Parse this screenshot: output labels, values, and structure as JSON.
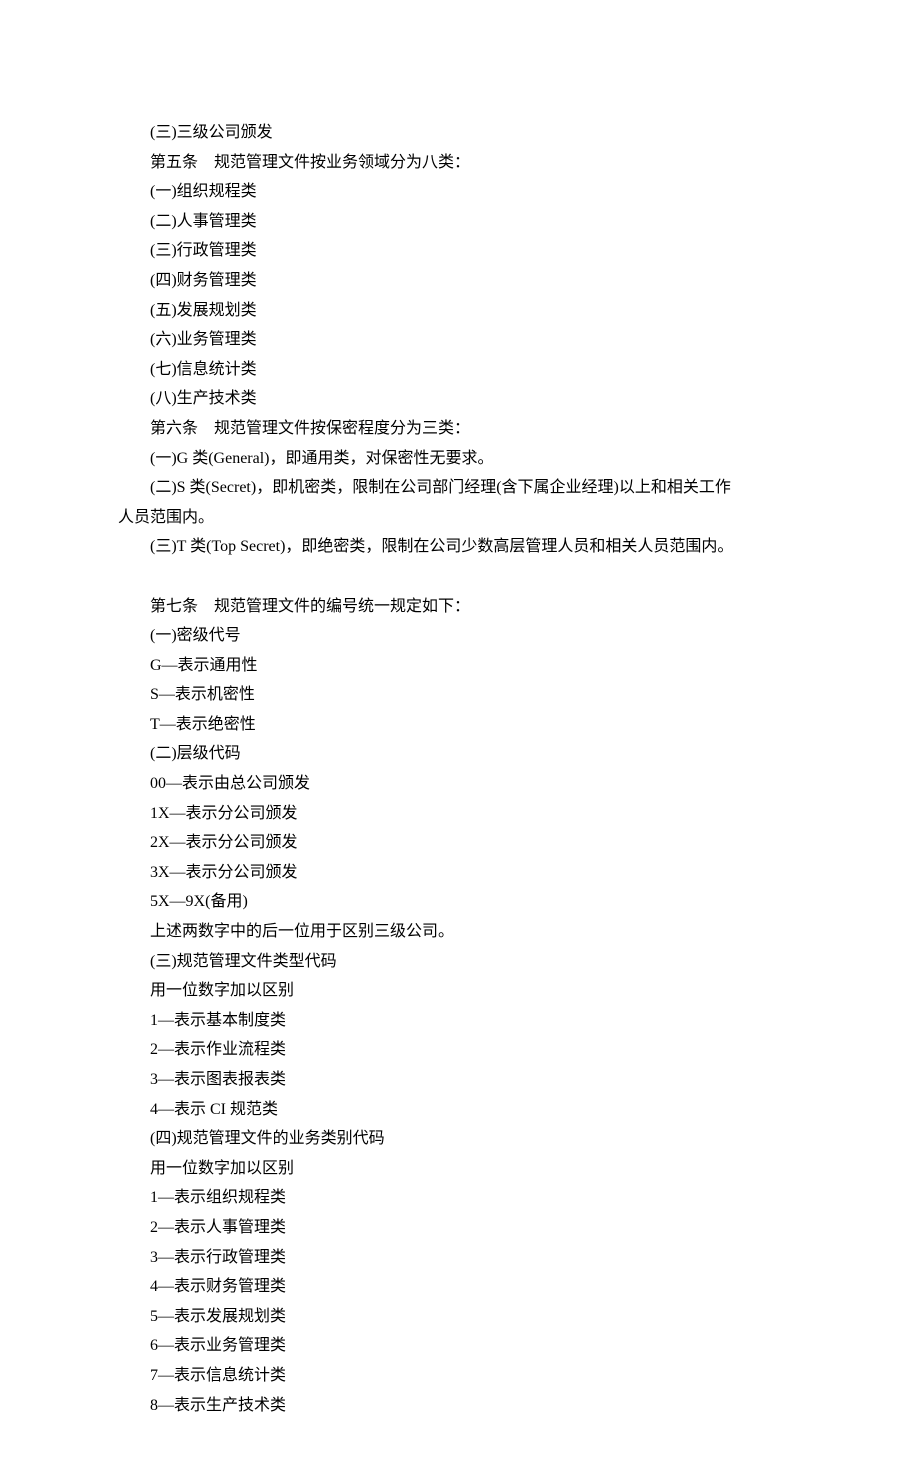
{
  "lines": [
    {
      "text": "(三)三级公司颁发",
      "indent": true
    },
    {
      "text": "第五条　规范管理文件按业务领域分为八类：",
      "indent": true
    },
    {
      "text": "(一)组织规程类",
      "indent": true
    },
    {
      "text": "(二)人事管理类",
      "indent": true
    },
    {
      "text": "(三)行政管理类",
      "indent": true
    },
    {
      "text": "(四)财务管理类",
      "indent": true
    },
    {
      "text": "(五)发展规划类",
      "indent": true
    },
    {
      "text": "(六)业务管理类",
      "indent": true
    },
    {
      "text": "(七)信息统计类",
      "indent": true
    },
    {
      "text": "(八)生产技术类",
      "indent": true
    },
    {
      "text": "第六条　规范管理文件按保密程度分为三类：",
      "indent": true
    },
    {
      "text": "(一)G 类(General)，即通用类，对保密性无要求。",
      "indent": true
    },
    {
      "text": "(二)S 类(Secret)，即机密类，限制在公司部门经理(含下属企业经理)以上和相关工作",
      "indent": true
    },
    {
      "text": "人员范围内。",
      "indent": false
    },
    {
      "text": "(三)T 类(Top Secret)，即绝密类，限制在公司少数高层管理人员和相关人员范围内。",
      "indent": true
    },
    {
      "spacer": true
    },
    {
      "text": "第七条　规范管理文件的编号统一规定如下：",
      "indent": true
    },
    {
      "text": "(一)密级代号",
      "indent": true
    },
    {
      "text": "G—表示通用性",
      "indent": true
    },
    {
      "text": "S—表示机密性",
      "indent": true
    },
    {
      "text": "T—表示绝密性",
      "indent": true
    },
    {
      "text": "(二)层级代码",
      "indent": true
    },
    {
      "text": "00—表示由总公司颁发",
      "indent": true
    },
    {
      "text": "1X—表示分公司颁发",
      "indent": true
    },
    {
      "text": "2X—表示分公司颁发",
      "indent": true
    },
    {
      "text": "3X—表示分公司颁发",
      "indent": true
    },
    {
      "text": "5X—9X(备用)",
      "indent": true
    },
    {
      "text": "上述两数字中的后一位用于区别三级公司。",
      "indent": true
    },
    {
      "text": "(三)规范管理文件类型代码",
      "indent": true
    },
    {
      "text": "用一位数字加以区别",
      "indent": true
    },
    {
      "text": "1—表示基本制度类",
      "indent": true
    },
    {
      "text": "2—表示作业流程类",
      "indent": true
    },
    {
      "text": "3—表示图表报表类",
      "indent": true
    },
    {
      "text": "4—表示 CI 规范类",
      "indent": true
    },
    {
      "text": "(四)规范管理文件的业务类别代码",
      "indent": true
    },
    {
      "text": "用一位数字加以区别",
      "indent": true
    },
    {
      "text": "1—表示组织规程类",
      "indent": true
    },
    {
      "text": "2—表示人事管理类",
      "indent": true
    },
    {
      "text": "3—表示行政管理类",
      "indent": true
    },
    {
      "text": "4—表示财务管理类",
      "indent": true
    },
    {
      "text": "5—表示发展规划类",
      "indent": true
    },
    {
      "text": "6—表示业务管理类",
      "indent": true
    },
    {
      "text": "7—表示信息统计类",
      "indent": true
    },
    {
      "text": "8—表示生产技术类",
      "indent": true
    }
  ]
}
